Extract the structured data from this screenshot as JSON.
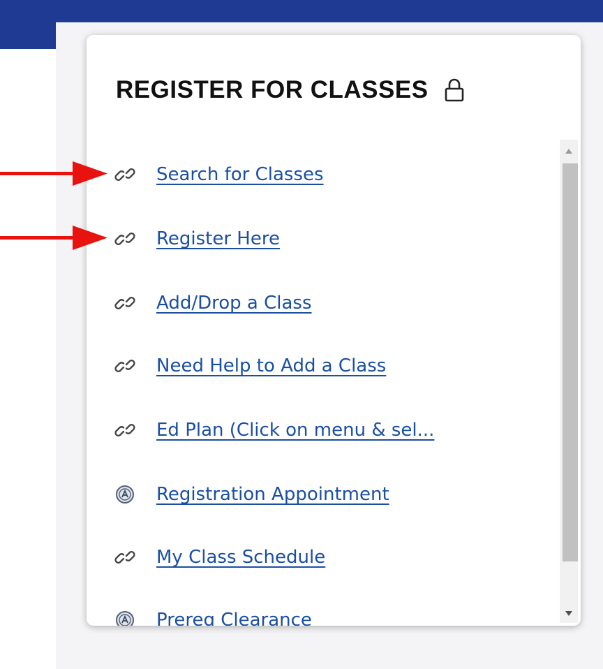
{
  "card": {
    "title": "REGISTER FOR CLASSES",
    "lock_icon": "lock-icon"
  },
  "links": [
    {
      "label": "Search for Classes",
      "icon": "link-icon"
    },
    {
      "label": "Register Here",
      "icon": "link-icon"
    },
    {
      "label": "Add/Drop a Class",
      "icon": "link-icon"
    },
    {
      "label": "Need Help to Add a Class",
      "icon": "link-icon"
    },
    {
      "label": "Ed Plan (Click on menu & sel...",
      "icon": "link-icon"
    },
    {
      "label": "Registration Appointment",
      "icon": "college-seal-icon"
    },
    {
      "label": "My Class Schedule",
      "icon": "link-icon"
    },
    {
      "label": "Prereq Clearance",
      "icon": "college-seal-icon"
    }
  ],
  "colors": {
    "header_blue": "#1f3a93",
    "link_blue": "#1a4fa3",
    "arrow_red": "#e8130f"
  }
}
